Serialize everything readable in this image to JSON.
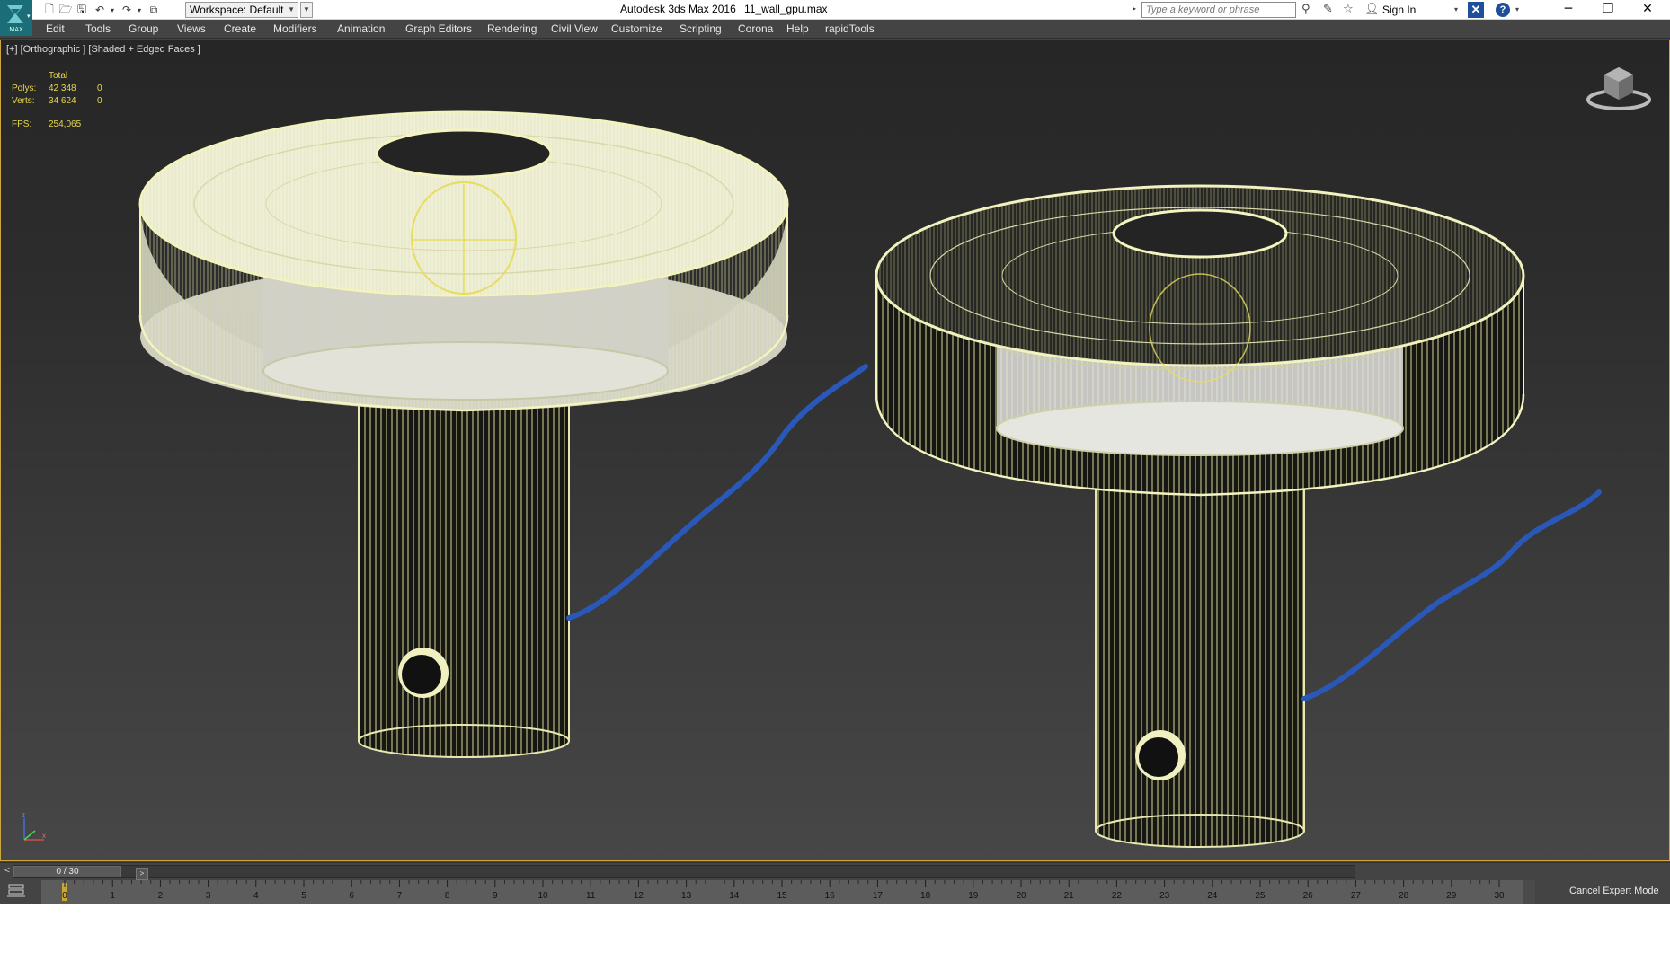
{
  "titlebar": {
    "app_title": "Autodesk 3ds Max 2016",
    "file_name": "11_wall_gpu.max",
    "logo_text": "MAX",
    "workspace_label": "Workspace: Default",
    "search_placeholder": "Type a keyword or phrase",
    "sign_in": "Sign In",
    "window_buttons": [
      "minimize",
      "restore",
      "close"
    ]
  },
  "menu": {
    "items": [
      "Edit",
      "Tools",
      "Group",
      "Views",
      "Create",
      "Modifiers",
      "Animation",
      "Graph Editors",
      "Rendering",
      "Civil View",
      "Customize",
      "Scripting",
      "Corona",
      "Help",
      "rapidTools"
    ]
  },
  "viewport": {
    "label": "[+] [Orthographic ] [Shaded + Edged Faces ]",
    "stats": {
      "total_label": "Total",
      "polys_label": "Polys:",
      "polys_total": "42 348",
      "polys_selected": "0",
      "verts_label": "Verts:",
      "verts_total": "34 624",
      "verts_selected": "0",
      "fps_label": "FPS:",
      "fps_value": "254,065"
    },
    "axis_labels": [
      "z",
      "x"
    ],
    "wire_color": "#f2f2b0",
    "cable_color": "#2a58b8"
  },
  "timeslider": {
    "position": "0 / 30",
    "current_frame": 0,
    "total_frames": 30
  },
  "trackbar": {
    "ticks": [
      "0",
      "1",
      "2",
      "3",
      "4",
      "5",
      "6",
      "7",
      "8",
      "9",
      "10",
      "11",
      "12",
      "13",
      "14",
      "15",
      "16",
      "17",
      "18",
      "19",
      "20",
      "21",
      "22",
      "23",
      "24",
      "25",
      "26",
      "27",
      "28",
      "29",
      "30"
    ],
    "cancel_expert_mode": "Cancel Expert Mode"
  },
  "colors": {
    "ui_dark": "#444444",
    "viewport_border": "#d0a640",
    "stats_yellow": "#e8d84c",
    "accent_blue": "#1d4f9a"
  }
}
